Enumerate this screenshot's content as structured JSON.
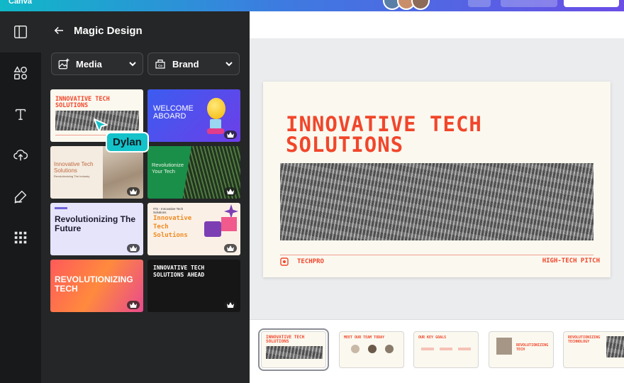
{
  "app": {
    "logo": "Canva"
  },
  "colors": {
    "accent": "#f1462b",
    "collab": "#14c2c9",
    "panel": "#252627",
    "rail": "#18191b"
  },
  "rail": {
    "items": [
      {
        "name": "design-icon",
        "active": true
      },
      {
        "name": "elements-icon"
      },
      {
        "name": "text-icon"
      },
      {
        "name": "uploads-icon"
      },
      {
        "name": "draw-icon"
      },
      {
        "name": "apps-icon"
      }
    ]
  },
  "panel": {
    "title": "Magic Design",
    "filters": {
      "media_label": "Media",
      "brand_label": "Brand"
    },
    "templates": [
      {
        "title": "INNOVATIVE TECH SOLUTIONS",
        "premium": false
      },
      {
        "title": "WELCOME ABOARD",
        "premium": true
      },
      {
        "title": "Innovative Tech Solutions",
        "subtitle": "Revolutionizing The Industry",
        "premium": true
      },
      {
        "title": "Revolutionize Your Tech",
        "premium": true
      },
      {
        "title": "Revolutionizing The Future",
        "premium": true
      },
      {
        "title": "Innovative Tech Solutions",
        "subtitle": "ITS - Innovative Tech Solutions",
        "premium": true
      },
      {
        "title": "REVOLUTIONIZING TECH",
        "premium": true
      },
      {
        "title": "INNOVATIVE TECH SOLUTIONS AHEAD",
        "premium": true
      }
    ],
    "collaborator": {
      "name": "Dylan"
    }
  },
  "canvas": {
    "title": "INNOVATIVE  TECH SOLUTIONS",
    "brand": "TECHPRO",
    "tagline": "HIGH-TECH PITCH"
  },
  "pages": [
    {
      "title": "INNOVATIVE TECH SOLUTIONS",
      "active": true
    },
    {
      "title": "MEET OUR TEAM TODAY"
    },
    {
      "title": "OUR KEY GOALS"
    },
    {
      "title": "REVOLUTIONIZING TECH"
    },
    {
      "title": "REVOLUTIONIZING TECHNOLOGY"
    }
  ]
}
